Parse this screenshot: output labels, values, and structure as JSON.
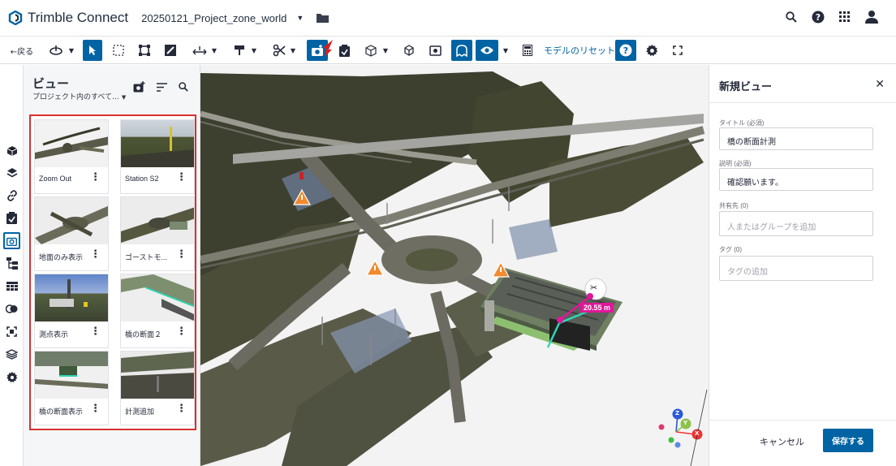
{
  "app": {
    "brand": "Trimble Connect",
    "project": "20250121_Project_zone_world"
  },
  "toolbar": {
    "back_label": "←戻る",
    "reset_label": "モデルのリセット"
  },
  "views_panel": {
    "title": "ビュー",
    "filter": "プロジェクト内のすべて…",
    "cards": [
      {
        "label": "Zoom Out"
      },
      {
        "label": "Station S2"
      },
      {
        "label": "地面のみ表示"
      },
      {
        "label": "ゴーストモ..."
      },
      {
        "label": "測点表示"
      },
      {
        "label": "橋の断面２"
      },
      {
        "label": "橋の断面表示"
      },
      {
        "label": "計測追加"
      }
    ]
  },
  "viewport": {
    "measurement": "20.55 m",
    "axis_labels": [
      "Z",
      "Y",
      "X"
    ]
  },
  "new_view": {
    "title": "新規ビュー",
    "title_label": "タイトル (必須)",
    "title_value": "橋の断面計測",
    "desc_label": "説明 (必須)",
    "desc_value": "確認願います。",
    "share_label": "共有先 (0)",
    "share_placeholder": "人またはグループを追加",
    "tag_label": "タグ (0)",
    "tag_placeholder": "タグの追加",
    "cancel_label": "キャンセル",
    "save_label": "保存する"
  },
  "colors": {
    "accent": "#0063a3",
    "highlight": "#d83030",
    "measure": "#e0179a"
  }
}
